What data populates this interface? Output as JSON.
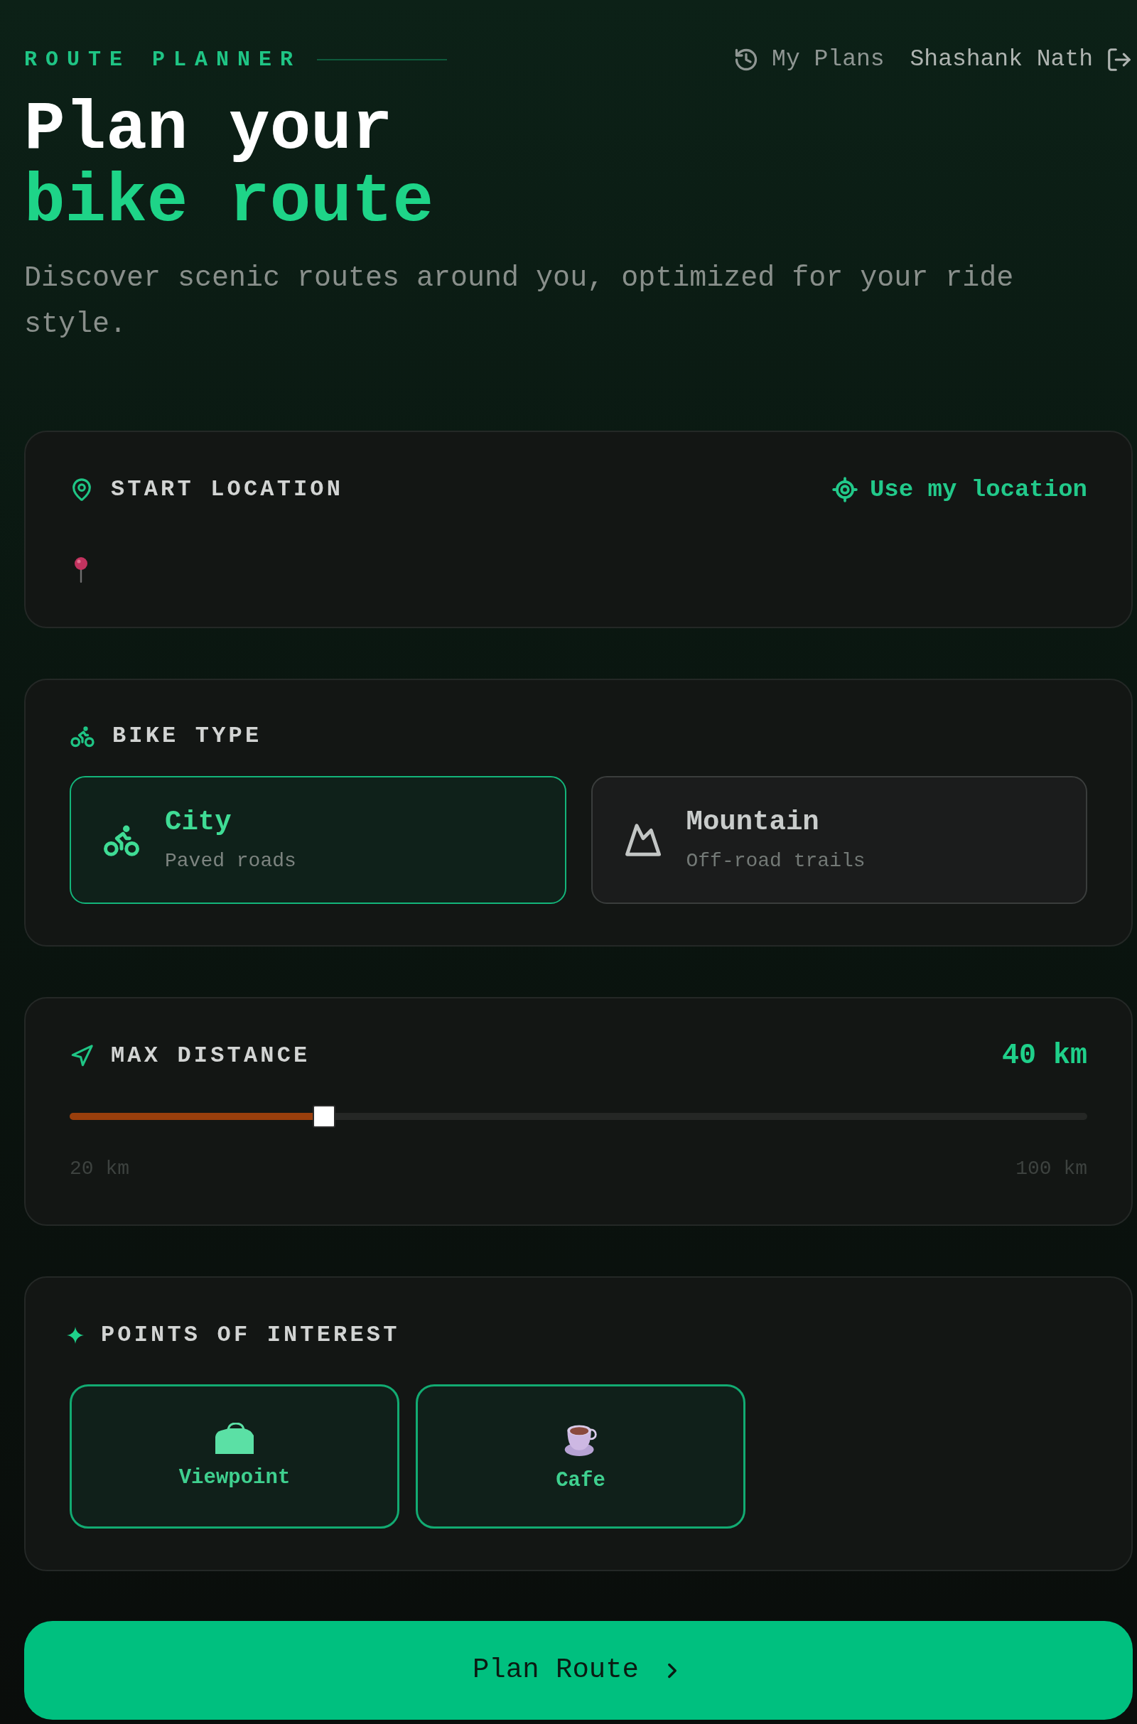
{
  "header": {
    "eyebrow": "ROUTE PLANNER",
    "nav": [
      {
        "kind": "link",
        "label": "My Plans"
      },
      {
        "kind": "user",
        "label": "Shashank Nath"
      }
    ]
  },
  "hero": {
    "title_line_1": "Plan your",
    "title_line_2": "bike route",
    "subtitle": "Discover scenic routes around you, optimized for your ride style."
  },
  "start_location": {
    "label": "START LOCATION",
    "action": "Use my location"
  },
  "bike_type": {
    "label": "BIKE TYPE",
    "options": [
      {
        "kind": "city",
        "title": "City",
        "subtitle": "Paved roads",
        "selected": true
      },
      {
        "kind": "mountain",
        "title": "Mountain",
        "subtitle": "Off-road trails",
        "selected": false
      }
    ]
  },
  "max_distance": {
    "label": "MAX DISTANCE",
    "reading": "40 km",
    "level": 0.25,
    "min_label": "20 km",
    "max_label": "100 km"
  },
  "points_of_interest": {
    "label": "POINTS OF INTEREST",
    "options": [
      {
        "kind": "viewpoint",
        "label": "Viewpoint",
        "selected": true
      },
      {
        "kind": "cafe",
        "label": "Cafe",
        "selected": true
      }
    ]
  },
  "primary_button": {
    "label": "Plan Route"
  }
}
